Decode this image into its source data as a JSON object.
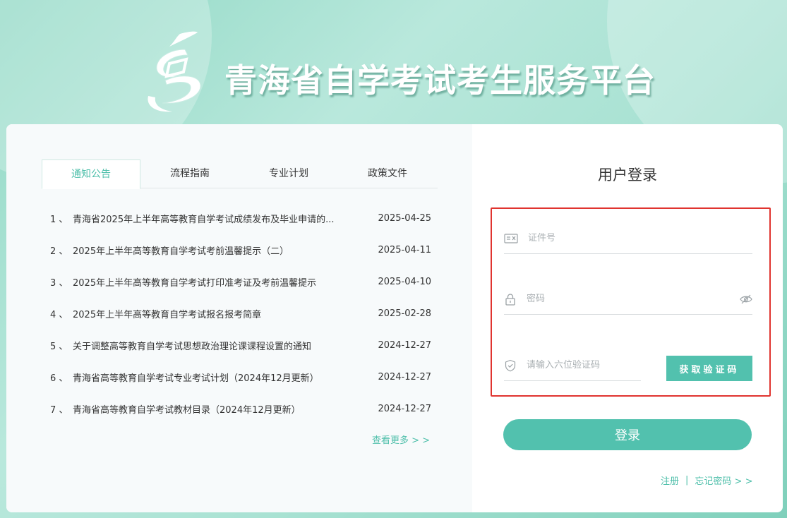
{
  "header": {
    "title": "青海省自学考试考生服务平台"
  },
  "tabs": [
    {
      "label": "通知公告"
    },
    {
      "label": "流程指南"
    },
    {
      "label": "专业计划"
    },
    {
      "label": "政策文件"
    }
  ],
  "notices": [
    {
      "num": "1 、",
      "title": "青海省2025年上半年高等教育自学考试成绩发布及毕业申请的...",
      "date": "2025-04-25"
    },
    {
      "num": "2 、",
      "title": "2025年上半年高等教育自学考试考前温馨提示（二）",
      "date": "2025-04-11"
    },
    {
      "num": "3 、",
      "title": "2025年上半年高等教育自学考试打印准考证及考前温馨提示",
      "date": "2025-04-10"
    },
    {
      "num": "4 、",
      "title": "2025年上半年高等教育自学考试报名报考简章",
      "date": "2025-02-28"
    },
    {
      "num": "5 、",
      "title": "关于调整高等教育自学考试思想政治理论课课程设置的通知",
      "date": "2024-12-27"
    },
    {
      "num": "6 、",
      "title": "青海省高等教育自学考试专业考试计划（2024年12月更新）",
      "date": "2024-12-27"
    },
    {
      "num": "7 、",
      "title": "青海省高等教育自学考试教材目录（2024年12月更新）",
      "date": "2024-12-27"
    }
  ],
  "more_link": "查看更多 > >",
  "login": {
    "title": "用户登录",
    "id_placeholder": "证件号",
    "password_placeholder": "密码",
    "code_placeholder": "请输入六位验证码",
    "get_code_button": "获取验证码",
    "login_button": "登录",
    "register_link": "注册",
    "separator": "|",
    "forgot_link": "忘记密码 > >"
  },
  "colors": {
    "accent": "#4ebfaa",
    "button": "#52c1ae",
    "highlight_border": "#e0342f"
  },
  "icons": [
    "logo-icon",
    "id-card-icon",
    "lock-icon",
    "eye-off-icon",
    "shield-icon"
  ]
}
